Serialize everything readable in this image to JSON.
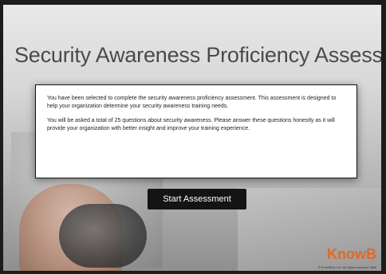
{
  "title": "Security Awareness Proficiency Assessment",
  "intro": {
    "paragraph_1": "You have been selected to complete the security awareness proficiency assessment. This assessment is designed to help your organization determine your security awareness training needs.",
    "paragraph_2": "You will be asked a total of 25 questions about security awareness. Please answer these questions honestly as it will provide your organization with better insight and improve your training experience."
  },
  "button": {
    "start_label": "Start Assessment"
  },
  "brand": {
    "logo_text": "KnowB",
    "copyright": "© KnowBe4, Inc. All rights reserved. Web",
    "accent_color": "#e26a1e"
  }
}
